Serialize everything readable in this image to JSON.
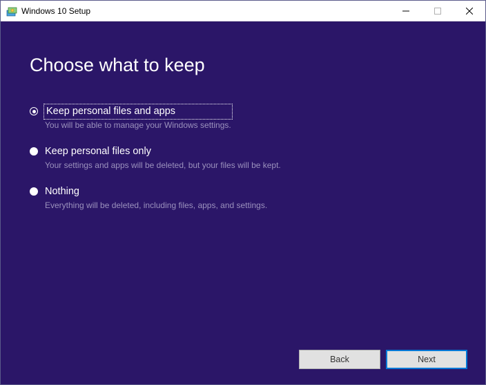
{
  "window": {
    "title": "Windows 10 Setup"
  },
  "heading": "Choose what to keep",
  "options": [
    {
      "label": "Keep personal files and apps",
      "description": "You will be able to manage your Windows settings.",
      "selected": true,
      "focused": true
    },
    {
      "label": "Keep personal files only",
      "description": "Your settings and apps will be deleted, but your files will be kept.",
      "selected": false,
      "focused": false
    },
    {
      "label": "Nothing",
      "description": "Everything will be deleted, including files, apps, and settings.",
      "selected": false,
      "focused": false
    }
  ],
  "buttons": {
    "back": "Back",
    "next": "Next"
  }
}
